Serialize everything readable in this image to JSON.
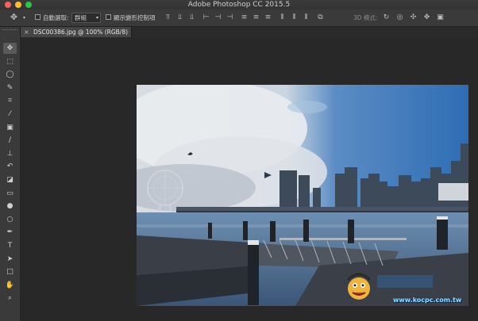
{
  "window": {
    "title": "Adobe Photoshop CC 2015.5"
  },
  "options_bar": {
    "auto_select_label": "自動選取:",
    "auto_select_value": "群組",
    "show_transform_label": "顯示變形控制項",
    "mode_3d_label": "3D 模式:"
  },
  "document_tab": {
    "close_glyph": "×",
    "label": "DSC00386.jpg @ 100% (RGB/8)"
  },
  "tools": [
    {
      "name": "move-tool",
      "glyph": "✥"
    },
    {
      "name": "marquee-tool",
      "glyph": "⬚"
    },
    {
      "name": "lasso-tool",
      "glyph": "◯"
    },
    {
      "name": "quick-select-tool",
      "glyph": "✎"
    },
    {
      "name": "crop-tool",
      "glyph": "⌗"
    },
    {
      "name": "eyedropper-tool",
      "glyph": "⁄"
    },
    {
      "name": "healing-tool",
      "glyph": "▣"
    },
    {
      "name": "brush-tool",
      "glyph": "∕"
    },
    {
      "name": "clone-stamp-tool",
      "glyph": "⊥"
    },
    {
      "name": "history-brush-tool",
      "glyph": "↶"
    },
    {
      "name": "eraser-tool",
      "glyph": "◪"
    },
    {
      "name": "gradient-tool",
      "glyph": "▭"
    },
    {
      "name": "blur-tool",
      "glyph": "●"
    },
    {
      "name": "dodge-tool",
      "glyph": "○"
    },
    {
      "name": "pen-tool",
      "glyph": "✒"
    },
    {
      "name": "type-tool",
      "glyph": "T"
    },
    {
      "name": "path-select-tool",
      "glyph": "➤"
    },
    {
      "name": "shape-tool",
      "glyph": "□"
    },
    {
      "name": "hand-tool",
      "glyph": "✋"
    },
    {
      "name": "zoom-tool",
      "glyph": "⌕"
    }
  ],
  "watermark": {
    "url_text": "www.kocpc.com.tw"
  },
  "colors": {
    "panel": "#3a3a3a",
    "canvas": "#282828",
    "accent_text": "#cfcfcf"
  }
}
